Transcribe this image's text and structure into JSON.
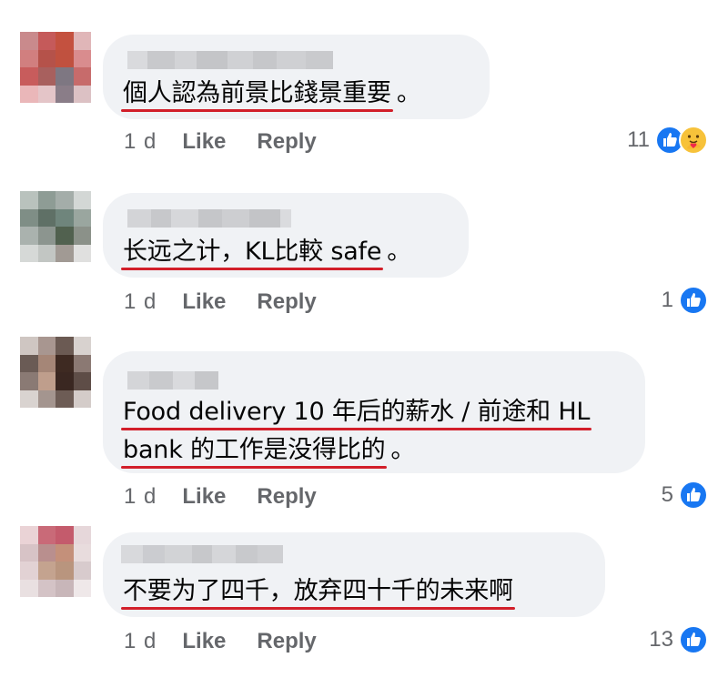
{
  "colors": {
    "bubble": "#f0f2f5",
    "text": "#050505",
    "meta": "#65676b",
    "underline": "#d21f2a",
    "like_blue": "#1877f2"
  },
  "comments": [
    {
      "text_lines": [
        "個人認為前景比錢景重要",
        "。"
      ],
      "time": "1 d",
      "like": "Like",
      "reply": "Reply",
      "reaction_count": "11",
      "reactions": [
        "like-icon",
        "care-icon"
      ]
    },
    {
      "text_lines": [
        "长远之计，KL比較 safe",
        "。"
      ],
      "time": "1 d",
      "like": "Like",
      "reply": "Reply",
      "reaction_count": "1",
      "reactions": [
        "like-icon"
      ]
    },
    {
      "text_lines": [
        "Food delivery 10 年后的薪水 / 前途和 HL",
        "bank 的工作是没得比的",
        "。"
      ],
      "time": "1 d",
      "like": "Like",
      "reply": "Reply",
      "reaction_count": "5",
      "reactions": [
        "like-icon"
      ]
    },
    {
      "text_lines": [
        "不要为了四千，放弃四十千的未来啊"
      ],
      "time": "1 d",
      "like": "Like",
      "reply": "Reply",
      "reaction_count": "13",
      "reactions": [
        "like-icon"
      ]
    }
  ]
}
